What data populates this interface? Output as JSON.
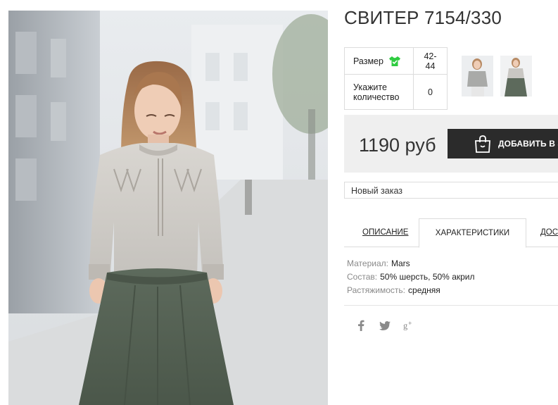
{
  "product": {
    "title": "СВИТЕР 7154/330"
  },
  "options": {
    "size_label": "Размер",
    "size_value": "42-44",
    "quantity_label": "Укажите количество",
    "quantity_value": "0"
  },
  "purchase": {
    "price": "1190 руб",
    "add_button_label": "ДОБАВИТЬ В ЗАКАЗ"
  },
  "order": {
    "selected": "Новый заказ"
  },
  "tabs": [
    {
      "label": "ОПИСАНИЕ"
    },
    {
      "label": "ХАРАКТЕРИСТИКИ"
    },
    {
      "label": "ДОСТАВКА"
    }
  ],
  "specs": [
    {
      "key": "Материал:",
      "value": "Mars"
    },
    {
      "key": "Состав:",
      "value": "50% шерсть, 50% акрил"
    },
    {
      "key": "Растяжимость:",
      "value": "средняя"
    }
  ],
  "social": [
    {
      "icon": "facebook-icon"
    },
    {
      "icon": "twitter-icon"
    },
    {
      "icon": "google-plus-icon"
    }
  ],
  "colors": {
    "button_bg": "#2b2b2b",
    "price_box_bg": "#efefef",
    "size_icon": "#2ecc40",
    "spec_key": "#8a8a8a"
  }
}
